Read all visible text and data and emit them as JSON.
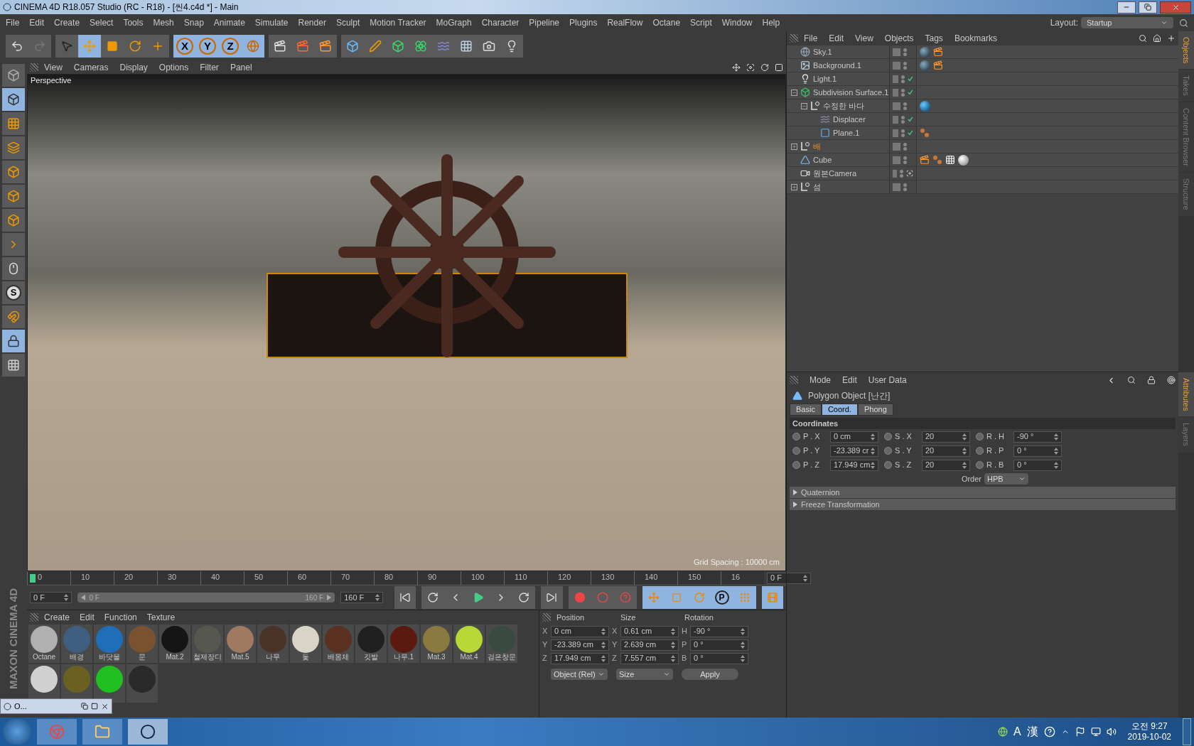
{
  "window": {
    "title": "CINEMA 4D R18.057 Studio (RC - R18) - [씬4.c4d *] - Main"
  },
  "menu": [
    "File",
    "Edit",
    "Create",
    "Select",
    "Tools",
    "Mesh",
    "Snap",
    "Animate",
    "Simulate",
    "Render",
    "Sculpt",
    "Motion Tracker",
    "MoGraph",
    "Character",
    "Pipeline",
    "Plugins",
    "RealFlow",
    "Octane",
    "Script",
    "Window",
    "Help"
  ],
  "layout": {
    "label": "Layout:",
    "value": "Startup"
  },
  "toolbar": {
    "axis_buttons": [
      {
        "label": "X",
        "selected": true
      },
      {
        "label": "Y",
        "selected": true
      },
      {
        "label": "Z",
        "selected": true
      }
    ]
  },
  "left_toolbar": {
    "snap_label": "S"
  },
  "viewport": {
    "menu": [
      "View",
      "Cameras",
      "Display",
      "Options",
      "Filter",
      "Panel"
    ],
    "camera": "Perspective",
    "grid_spacing": "Grid Spacing : 10000 cm"
  },
  "timeline": {
    "ticks": [
      "0",
      "10",
      "20",
      "30",
      "40",
      "50",
      "60",
      "70",
      "80",
      "90",
      "100",
      "110",
      "120",
      "130",
      "140",
      "150",
      "16"
    ],
    "current_frame": "0 F",
    "start_field": "0 F",
    "range": {
      "start": "0 F",
      "end": "160 F",
      "level": 1
    },
    "end_field": "160 F",
    "level": 0.0,
    "point_label": "P"
  },
  "materials": {
    "menu": [
      "Create",
      "Edit",
      "Function",
      "Texture"
    ],
    "items": [
      {
        "name": "Octane",
        "color": "#b0b0b0"
      },
      {
        "name": "배경",
        "color": "#3f5f80"
      },
      {
        "name": "바닷물",
        "color": "#1f6fb8"
      },
      {
        "name": "문",
        "color": "#7a5230"
      },
      {
        "name": "Mat.2",
        "color": "#151515"
      },
      {
        "name": "철제장디",
        "color": "#56574f"
      },
      {
        "name": "Mat.5",
        "color": "#a07a60"
      },
      {
        "name": "나무",
        "color": "#4a3428"
      },
      {
        "name": "돛",
        "color": "#d8d4c8"
      },
      {
        "name": "배몸체",
        "color": "#5a3020"
      },
      {
        "name": "깃발",
        "color": "#202020"
      },
      {
        "name": "나무.1",
        "color": "#5a1a10"
      },
      {
        "name": "Mat.3",
        "color": "#8a7a40"
      },
      {
        "name": "Mat.4",
        "color": "#b8d838"
      },
      {
        "name": "검은창문",
        "color": "#3a4a40"
      },
      {
        "color": "#d0d0d0"
      },
      {
        "color": "#6a6020"
      },
      {
        "color": "#20c020"
      },
      {
        "color": "#2a2a2a"
      }
    ]
  },
  "coordinates": {
    "headers": [
      "Position",
      "Size",
      "Rotation"
    ],
    "rows": [
      {
        "position_axis": "X",
        "position": "0 cm",
        "size_axis": "X",
        "size": "0.61 cm",
        "rotation_axis": "H",
        "rotation": "-90 °"
      },
      {
        "position_axis": "Y",
        "position": "-23.389 cm",
        "size_axis": "Y",
        "size": "2.639 cm",
        "rotation_axis": "P",
        "rotation": "0 °"
      },
      {
        "position_axis": "Z",
        "position": "17.949 cm",
        "size_axis": "Z",
        "size": "7.557 cm",
        "rotation_axis": "B",
        "rotation": "0 °"
      }
    ],
    "mode": "Object (Rel)",
    "size_mode": "Size",
    "apply": "Apply"
  },
  "object_manager": {
    "menu": [
      "File",
      "Edit",
      "View",
      "Objects",
      "Tags",
      "Bookmarks"
    ],
    "objects": [
      {
        "name": "Sky.1",
        "kind": "sky",
        "highlighted": false,
        "checked": false,
        "tags": [
          {
            "kind": "material"
          },
          {
            "kind": "render"
          }
        ]
      },
      {
        "name": "Background.1",
        "kind": "background",
        "highlighted": false,
        "checked": false,
        "tags": [
          {
            "kind": "material"
          },
          {
            "kind": "render"
          }
        ]
      },
      {
        "name": "Light.1",
        "kind": "light",
        "highlighted": false,
        "checked": true
      },
      {
        "name": "Subdivision Surface.1",
        "kind": "subdivision",
        "expanded": true,
        "highlighted": false,
        "checked": true,
        "children": [
          {
            "name": "수정한 바다",
            "kind": "null",
            "expanded": true,
            "highlighted": false,
            "checked": false,
            "tags": [
              {
                "kind": "material_blue"
              }
            ],
            "children": [
              {
                "name": "Displacer",
                "kind": "displacer",
                "highlighted": false,
                "checked": true
              },
              {
                "name": "Plane.1",
                "kind": "plane",
                "highlighted": false,
                "checked": true,
                "tags": [
                  {
                    "kind": "phong"
                  }
                ]
              }
            ]
          }
        ]
      },
      {
        "name": "배",
        "kind": "null",
        "expanded": false,
        "highlighted": true,
        "checked": false
      },
      {
        "name": "Cube",
        "kind": "polygon",
        "highlighted": false,
        "checked": false,
        "tags": [
          {
            "kind": "render"
          },
          {
            "kind": "phong"
          },
          {
            "kind": "checker"
          },
          {
            "kind": "sphere"
          }
        ]
      },
      {
        "name": "원본Camera",
        "kind": "camera",
        "highlighted": false,
        "checked": false,
        "target": true
      },
      {
        "name": "섬",
        "kind": "null",
        "expanded": false,
        "highlighted": false,
        "checked": false
      }
    ]
  },
  "side_tabs_top": [
    {
      "label": "Objects",
      "selected": true
    },
    {
      "label": "Takes",
      "selected": false
    },
    {
      "label": "Content Browser",
      "selected": false
    },
    {
      "label": "Structure",
      "selected": false
    }
  ],
  "side_tabs_bottom": [
    {
      "label": "Attributes",
      "selected": true
    },
    {
      "label": "Layers",
      "selected": false
    }
  ],
  "attributes": {
    "menu": [
      "Mode",
      "Edit",
      "User Data"
    ],
    "title": "Polygon Object [난간]",
    "tabs": [
      {
        "label": "Basic",
        "selected": false
      },
      {
        "label": "Coord.",
        "selected": true
      },
      {
        "label": "Phong",
        "selected": false
      }
    ],
    "section": "Coordinates",
    "fields": [
      [
        {
          "label": "P . X",
          "value": "0 cm",
          "keyframed": false
        },
        {
          "label": "S . X",
          "value": "20",
          "keyframed": false
        },
        {
          "label": "R . H",
          "value": "-90 °",
          "keyframed": false
        }
      ],
      [
        {
          "label": "P . Y",
          "value": "-23.389 cr",
          "keyframed": false
        },
        {
          "label": "S . Y",
          "value": "20",
          "keyframed": false
        },
        {
          "label": "R . P",
          "value": "0 °",
          "keyframed": false
        }
      ],
      [
        {
          "label": "P . Z",
          "value": "17.949 cm",
          "keyframed": false
        },
        {
          "label": "S . Z",
          "value": "20",
          "keyframed": false
        },
        {
          "label": "R . B",
          "value": "0 °",
          "keyframed": false
        }
      ]
    ],
    "order_label": "Order",
    "order_value": "HPB",
    "groups": [
      {
        "label": "Quaternion",
        "expanded": false
      },
      {
        "label": "Freeze Transformation",
        "expanded": false
      }
    ]
  },
  "brand": "MAXON CINEMA 4D",
  "mini_window": {
    "title": "O..."
  },
  "taskbar": {
    "tray": [
      "A",
      "漢"
    ],
    "time": "오전 9:27",
    "date": "2019-10-02"
  }
}
